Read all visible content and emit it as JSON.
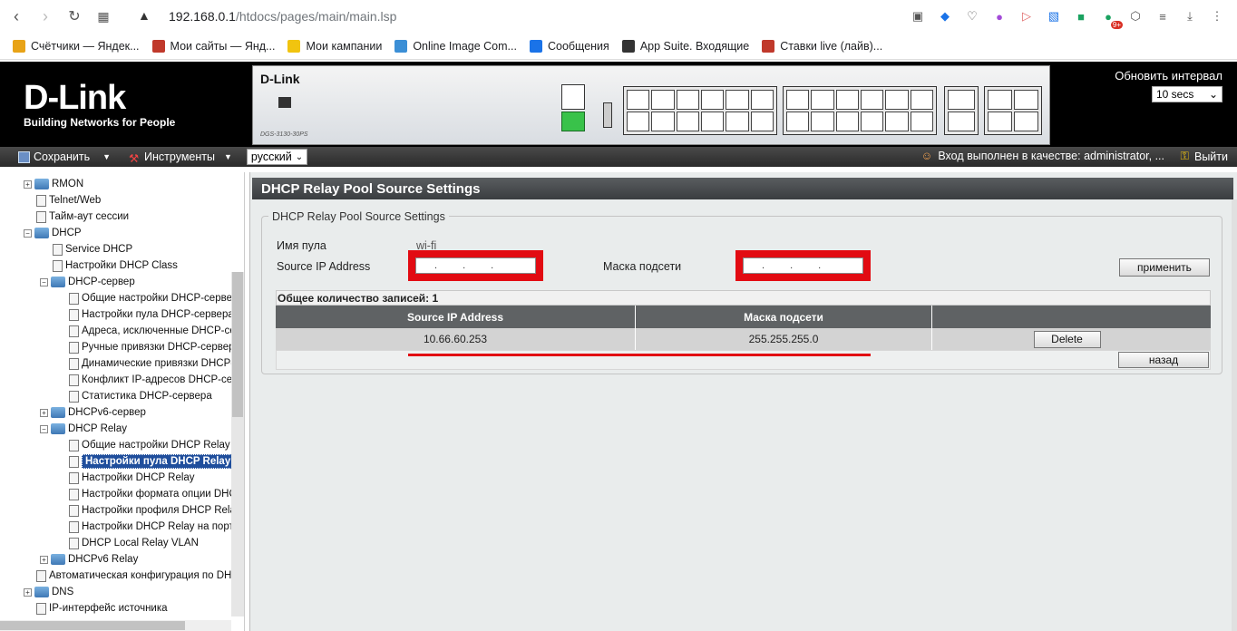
{
  "browser": {
    "url_host": "192.168.0.1",
    "url_path": "/htdocs/pages/main/main.lsp",
    "badge": "9+"
  },
  "bookmarks": [
    {
      "label": "Счётчики — Яндек...",
      "color": "#e8a317"
    },
    {
      "label": "Мои сайты — Янд...",
      "color": "#c0392b"
    },
    {
      "label": "Мои кампании",
      "color": "#f1c40f"
    },
    {
      "label": "Online Image Com...",
      "color": "#3b8fd6"
    },
    {
      "label": "Сообщения",
      "color": "#1a73e8"
    },
    {
      "label": "App Suite. Входящие",
      "color": "#333333"
    },
    {
      "label": "Ставки live (лайв)...",
      "color": "#c0392b"
    }
  ],
  "header": {
    "logo": "D-Link",
    "slogan": "Building Networks for People",
    "device_name": "D-Link",
    "device_model": "DGS-3130-30PS",
    "refresh_label": "Обновить интервал",
    "refresh_value": "10 secs"
  },
  "menubar": {
    "save": "Сохранить",
    "tools": "Инструменты",
    "language": "русский",
    "login": "Вход выполнен в качестве: administrator, ...",
    "logout": "Выйти"
  },
  "tree": [
    {
      "label": "RMON",
      "type": "folder",
      "level": 0,
      "expander": "+"
    },
    {
      "label": "Telnet/Web",
      "type": "doc",
      "level": 0
    },
    {
      "label": "Тайм-аут сессии",
      "type": "doc",
      "level": 0
    },
    {
      "label": "DHCP",
      "type": "folder",
      "level": 0,
      "expander": "−"
    },
    {
      "label": "Service DHCP",
      "type": "doc",
      "level": 1
    },
    {
      "label": "Настройки DHCP Class",
      "type": "doc",
      "level": 1
    },
    {
      "label": "DHCP-сервер",
      "type": "folder",
      "level": 1,
      "expander": "−"
    },
    {
      "label": "Общие настройки DHCP-сервер",
      "type": "doc",
      "level": 2
    },
    {
      "label": "Настройки пула DHCP-сервера",
      "type": "doc",
      "level": 2
    },
    {
      "label": "Адреса, исключенные DHCP-се",
      "type": "doc",
      "level": 2
    },
    {
      "label": "Ручные привязки DHCP-сервер",
      "type": "doc",
      "level": 2
    },
    {
      "label": "Динамические привязки DHCP-",
      "type": "doc",
      "level": 2
    },
    {
      "label": "Конфликт IP-адресов DHCP-сер",
      "type": "doc",
      "level": 2
    },
    {
      "label": "Статистика DHCP-сервера",
      "type": "doc",
      "level": 2
    },
    {
      "label": "DHCPv6-сервер",
      "type": "folder",
      "level": 1,
      "expander": "+"
    },
    {
      "label": "DHCP Relay",
      "type": "folder",
      "level": 1,
      "expander": "−"
    },
    {
      "label": "Общие настройки DHCP Relay",
      "type": "doc",
      "level": 2
    },
    {
      "label": "Настройки пула DHCP Relay",
      "type": "doc",
      "level": 2,
      "selected": true
    },
    {
      "label": "Настройки DHCP Relay",
      "type": "doc",
      "level": 2
    },
    {
      "label": "Настройки формата опции DHC",
      "type": "doc",
      "level": 2
    },
    {
      "label": "Настройки профиля DHCP Rela",
      "type": "doc",
      "level": 2
    },
    {
      "label": "Настройки DHCP Relay на порт",
      "type": "doc",
      "level": 2
    },
    {
      "label": "DHCP Local Relay VLAN",
      "type": "doc",
      "level": 2
    },
    {
      "label": "DHCPv6 Relay",
      "type": "folder",
      "level": 1,
      "expander": "+"
    },
    {
      "label": "Автоматическая конфигурация по DHC",
      "type": "doc",
      "level": 0
    },
    {
      "label": "DNS",
      "type": "folder",
      "level": 0,
      "expander": "+"
    },
    {
      "label": "IP-интерфейс источника",
      "type": "doc",
      "level": 0
    }
  ],
  "main": {
    "title": "DHCP Relay Pool Source Settings",
    "legend": "DHCP Relay Pool Source Settings",
    "pool_name_label": "Имя пула",
    "pool_name_value": "wi-fi",
    "source_ip_label": "Source IP Address",
    "mask_label": "Маска подсети",
    "apply_button": "применить",
    "total_entries": "Общее количество записей: 1",
    "columns": [
      "Source IP Address",
      "Маска подсети",
      ""
    ],
    "rows": [
      {
        "source_ip": "10.66.60.253",
        "mask": "255.255.255.0",
        "action": "Delete"
      }
    ],
    "back_button": "назад"
  },
  "colors": {
    "highlight_red": "#e20b12",
    "title_bar": "#4a4d50",
    "table_header": "#5f6264",
    "selected_tree": "#1f4e9c"
  }
}
